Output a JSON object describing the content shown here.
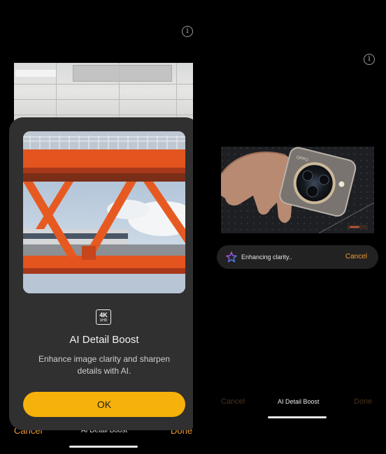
{
  "left_screen": {
    "info_icon": "info-circle-icon",
    "dialog": {
      "badge_top": "4K",
      "badge_bottom": "UHD",
      "title": "AI Detail Boost",
      "description": "Enhance image clarity and sharpen details with AI.",
      "ok_label": "OK"
    },
    "toolbar": {
      "cancel_label": "Cancel",
      "title": "AI Detail Boost",
      "done_label": "Done"
    }
  },
  "right_screen": {
    "info_icon": "info-circle-icon",
    "status": {
      "icon": "sparkle-star-icon",
      "text": "Enhancing clarity..",
      "cancel_label": "Cancel"
    },
    "toolbar": {
      "cancel_label": "Cancel",
      "title": "AI Detail Boost",
      "done_label": "Done"
    }
  },
  "colors": {
    "accent_orange": "#f39a2e",
    "ok_button": "#f6b10a",
    "dialog_bg": "#303030",
    "status_bar_bg": "#222222"
  }
}
